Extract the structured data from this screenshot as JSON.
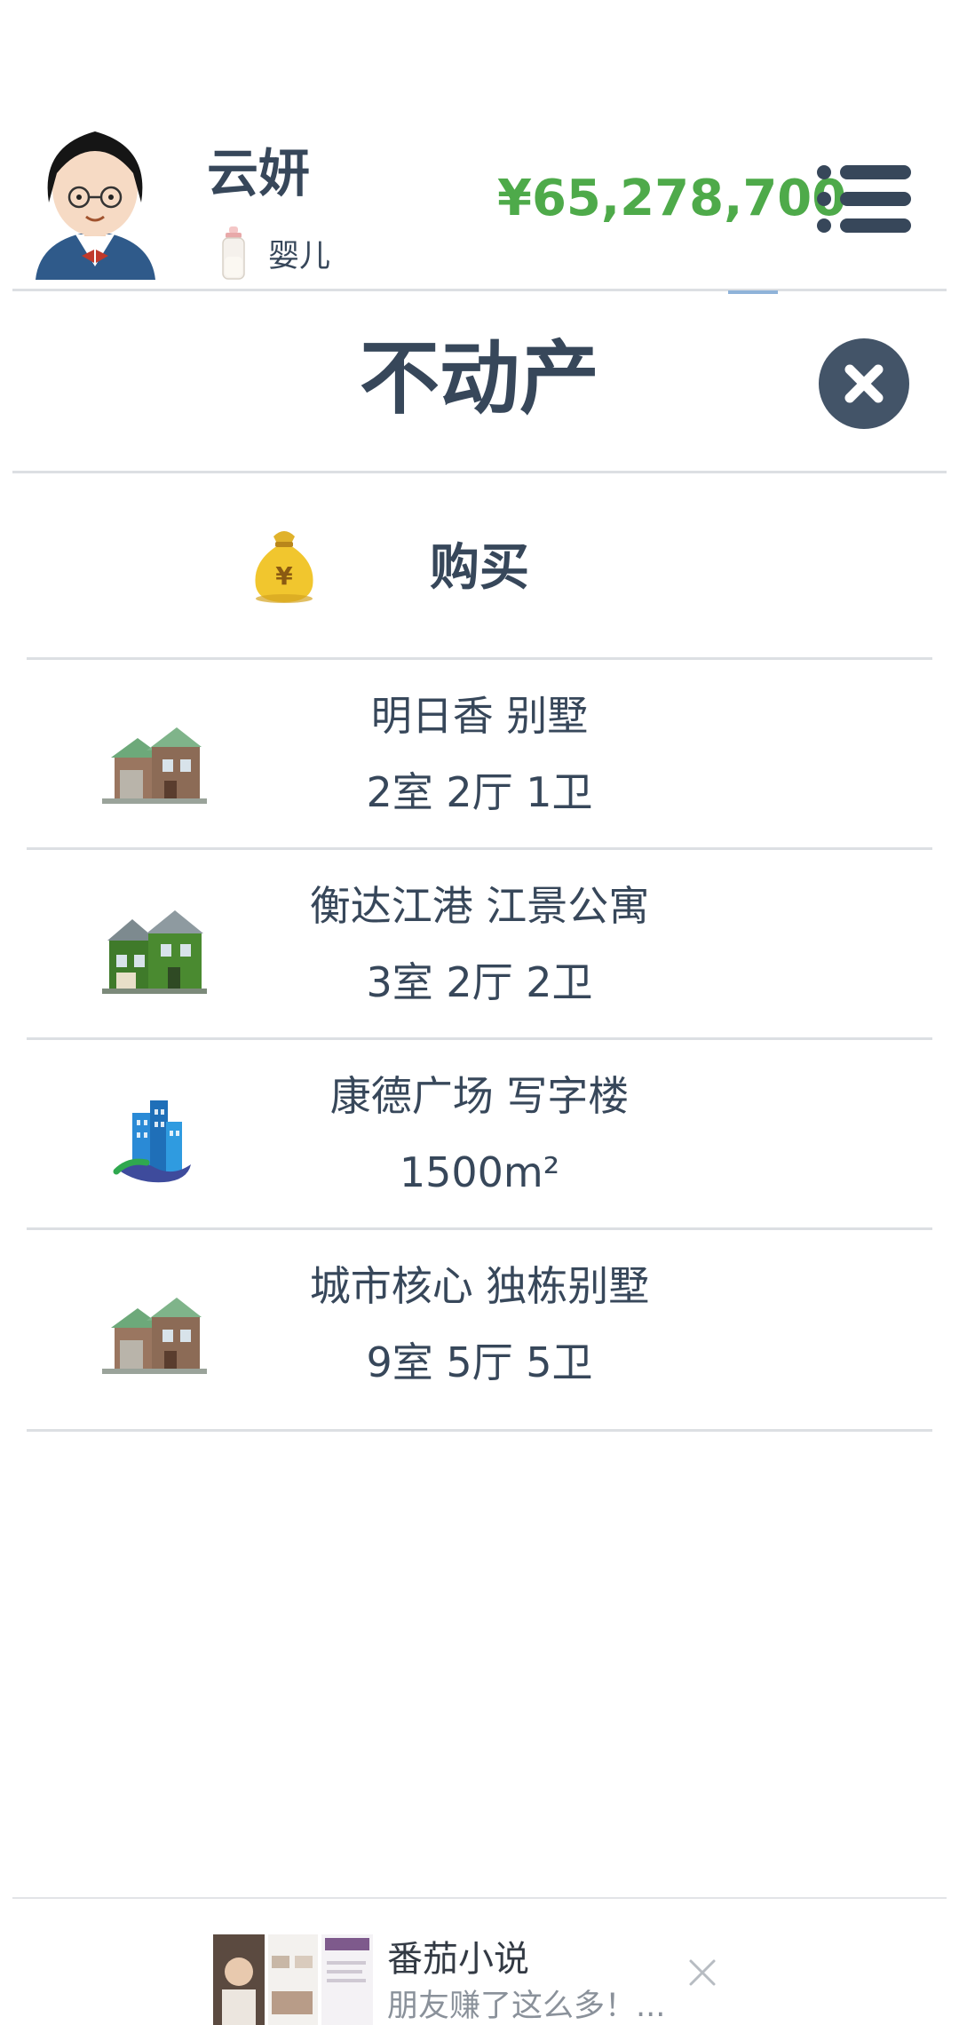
{
  "player": {
    "name": "云妍",
    "age_stage": "婴儿",
    "money": "¥65,278,700"
  },
  "panel": {
    "title": "不动产",
    "buy_label": "购买"
  },
  "properties": [
    {
      "name": "明日香 别墅",
      "layout": "2室 2厅 1卫",
      "icon": "brown-villa-icon"
    },
    {
      "name": "衡达江港 江景公寓",
      "layout": "3室 2厅 2卫",
      "icon": "green-apartment-icon"
    },
    {
      "name": "康德广场 写字楼",
      "layout": "1500m²",
      "icon": "office-tower-icon"
    },
    {
      "name": "城市核心 独栋别墅",
      "layout": "9室 5厅 5卫",
      "icon": "brown-villa-icon"
    }
  ],
  "ad": {
    "title": "番茄小说",
    "subtitle": "朋友赚了这么多！..."
  },
  "colors": {
    "text": "#37475a",
    "money": "#4eaa4a",
    "close_button": "#435468",
    "divider": "#dcdfe3"
  }
}
